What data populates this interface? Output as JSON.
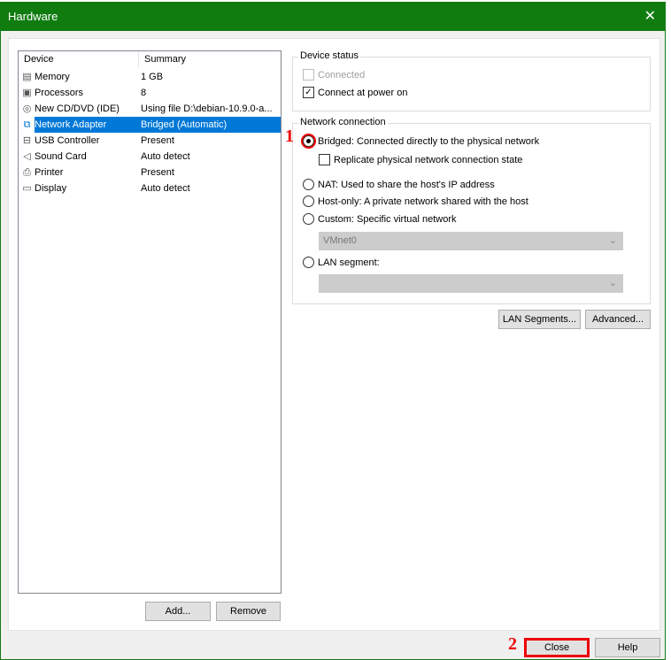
{
  "window": {
    "title": "Hardware"
  },
  "device_list": {
    "columns": [
      "Device",
      "Summary"
    ],
    "rows": [
      {
        "icon": "memory-icon",
        "device": "Memory",
        "summary": "1 GB"
      },
      {
        "icon": "processor-icon",
        "device": "Processors",
        "summary": "8"
      },
      {
        "icon": "cd-dvd-icon",
        "device": "New CD/DVD (IDE)",
        "summary": "Using file D:\\debian-10.9.0-a..."
      },
      {
        "icon": "network-adapter-icon",
        "device": "Network Adapter",
        "summary": "Bridged (Automatic)",
        "selected": true
      },
      {
        "icon": "usb-icon",
        "device": "USB Controller",
        "summary": "Present"
      },
      {
        "icon": "sound-icon",
        "device": "Sound Card",
        "summary": "Auto detect"
      },
      {
        "icon": "printer-icon",
        "device": "Printer",
        "summary": "Present"
      },
      {
        "icon": "display-icon",
        "device": "Display",
        "summary": "Auto detect"
      }
    ],
    "add_label": "Add...",
    "remove_label": "Remove"
  },
  "device_status": {
    "legend": "Device status",
    "connected": {
      "label": "Connected",
      "checked": false,
      "disabled": true
    },
    "connect_at_power_on": {
      "label": "Connect at power on",
      "checked": true
    }
  },
  "network_connection": {
    "legend": "Network connection",
    "bridged": "Bridged: Connected directly to the physical network",
    "replicate": "Replicate physical network connection state",
    "nat": "NAT: Used to share the host's IP address",
    "host_only": "Host-only: A private network shared with the host",
    "custom": "Custom: Specific virtual network",
    "custom_value": "VMnet0",
    "lan_segment": "LAN segment:",
    "lan_value": "",
    "selected": "bridged"
  },
  "buttons": {
    "lan_segments": "LAN Segments...",
    "advanced": "Advanced...",
    "close": "Close",
    "help": "Help"
  },
  "annotations": {
    "step1": "1",
    "step2": "2"
  }
}
